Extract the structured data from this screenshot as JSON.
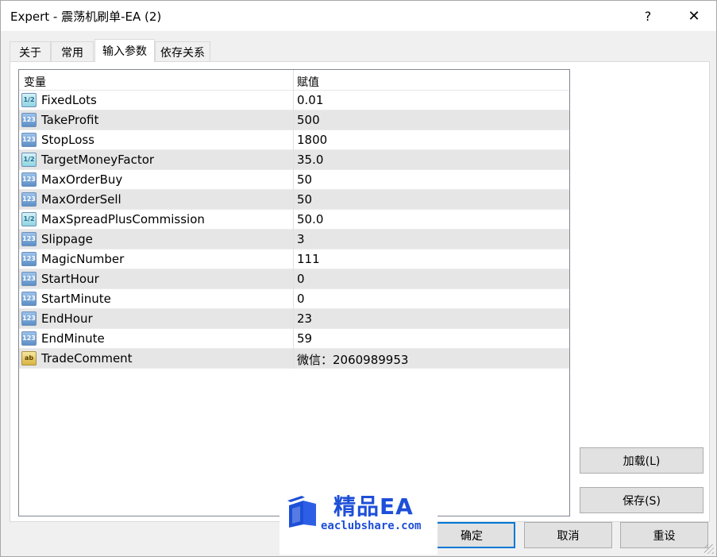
{
  "window": {
    "title": "Expert - 震荡机刷单-EA (2)",
    "help_label": "?",
    "close_label": "✕"
  },
  "tabs": [
    {
      "label": "关于",
      "active": false
    },
    {
      "label": "常用",
      "active": false
    },
    {
      "label": "输入参数",
      "active": true
    },
    {
      "label": "依存关系",
      "active": false
    }
  ],
  "grid": {
    "columns": [
      "变量",
      "赋值"
    ],
    "rows": [
      {
        "type": "double",
        "icon": "1/2",
        "name": "FixedLots",
        "value": "0.01"
      },
      {
        "type": "int",
        "icon": "123",
        "name": "TakeProfit",
        "value": "500"
      },
      {
        "type": "int",
        "icon": "123",
        "name": "StopLoss",
        "value": "1800"
      },
      {
        "type": "double",
        "icon": "1/2",
        "name": "TargetMoneyFactor",
        "value": "35.0"
      },
      {
        "type": "int",
        "icon": "123",
        "name": "MaxOrderBuy",
        "value": "50"
      },
      {
        "type": "int",
        "icon": "123",
        "name": "MaxOrderSell",
        "value": "50"
      },
      {
        "type": "double",
        "icon": "1/2",
        "name": "MaxSpreadPlusCommission",
        "value": "50.0"
      },
      {
        "type": "int",
        "icon": "123",
        "name": "Slippage",
        "value": "3"
      },
      {
        "type": "int",
        "icon": "123",
        "name": "MagicNumber",
        "value": "111"
      },
      {
        "type": "int",
        "icon": "123",
        "name": "StartHour",
        "value": "0"
      },
      {
        "type": "int",
        "icon": "123",
        "name": "StartMinute",
        "value": "0"
      },
      {
        "type": "int",
        "icon": "123",
        "name": "EndHour",
        "value": "23"
      },
      {
        "type": "int",
        "icon": "123",
        "name": "EndMinute",
        "value": "59"
      },
      {
        "type": "string",
        "icon": "ab",
        "name": "TradeComment",
        "value": "微信：2060989953"
      }
    ]
  },
  "buttons": {
    "load": "加载(L)",
    "save": "保存(S)",
    "ok": "确定",
    "cancel": "取消",
    "reset": "重设"
  },
  "watermark": {
    "brand": "精品EA",
    "url": "eaclubshare.com"
  },
  "colors": {
    "brand_blue": "#1e4fd8",
    "focus_blue": "#0078d7"
  }
}
